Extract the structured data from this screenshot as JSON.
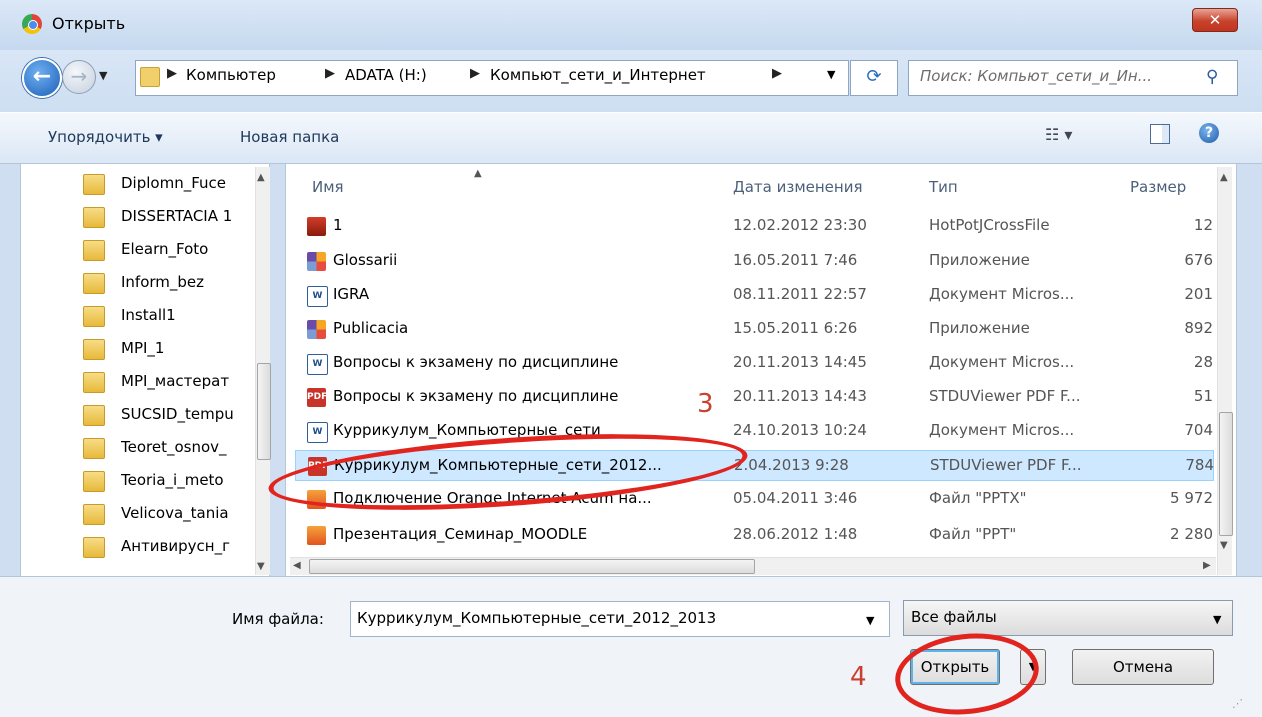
{
  "window": {
    "title": "Открыть",
    "close_label": "✕"
  },
  "nav": {
    "breadcrumbs": [
      "Компьютер",
      "ADATA (H:)",
      "Компьют_сети_и_Интернет"
    ],
    "search_placeholder": "Поиск: Компьют_сети_и_Ин..."
  },
  "toolbar": {
    "organize_label": "Упорядочить ▾",
    "new_folder_label": "Новая папка"
  },
  "sidebar": {
    "items": [
      "Diplomn_Fuce",
      "DISSERTACIA 1",
      "Elearn_Foto",
      "Inform_bez",
      "Install1",
      "MPI_1",
      "MPI_мастерат",
      "SUCSID_tempu",
      "Teoret_osnov_",
      "Teoria_i_meto",
      "Velicova_tania",
      "Антивирусн_г"
    ]
  },
  "columns": {
    "name": "Имя",
    "date": "Дата изменения",
    "type": "Тип",
    "size": "Размер"
  },
  "files": [
    {
      "icon": "hotpot-icon",
      "name": "1",
      "date": "12.02.2012 23:30",
      "type": "HotPotJCrossFile",
      "size": "12"
    },
    {
      "icon": "application-icon",
      "name": "Glossarii",
      "date": "16.05.2011 7:46",
      "type": "Приложение",
      "size": "676"
    },
    {
      "icon": "word-document-icon",
      "name": "IGRA",
      "date": "08.11.2011 22:57",
      "type": "Документ Micros...",
      "size": "201"
    },
    {
      "icon": "application-icon",
      "name": "Publicacia",
      "date": "15.05.2011 6:26",
      "type": "Приложение",
      "size": "892"
    },
    {
      "icon": "word-document-icon",
      "name": "Вопросы к экзамену по дисциплине",
      "date": "20.11.2013 14:45",
      "type": "Документ Micros...",
      "size": "28"
    },
    {
      "icon": "pdf-icon",
      "name": "Вопросы к экзамену по дисциплине",
      "date": "20.11.2013 14:43",
      "type": "STDUViewer PDF F...",
      "size": "51"
    },
    {
      "icon": "word-document-icon",
      "name": "Куррикулум_Компьютерные_сети",
      "date": "24.10.2013 10:24",
      "type": "Документ Micros...",
      "size": "704"
    },
    {
      "icon": "pdf-icon",
      "name": "Куррикулум_Компьютерные_сети_2012...",
      "date": "2.04.2013 9:28",
      "type": "STDUViewer PDF F...",
      "size": "784",
      "selected": true
    },
    {
      "icon": "powerpoint-icon",
      "name": "Подключение Orange Internet Acum на...",
      "date": "05.04.2011 3:46",
      "type": "Файл \"PPTX\"",
      "size": "5 972"
    },
    {
      "icon": "powerpoint-icon",
      "name": "Презентация_Семинар_MOODLE",
      "date": "28.06.2012 1:48",
      "type": "Файл \"PPT\"",
      "size": "2 280"
    }
  ],
  "footer": {
    "filename_label": "Имя файла:",
    "filename_value": "Куррикулум_Компьютерные_сети_2012_2013",
    "filetype_value": "Все файлы",
    "open_label": "Открыть",
    "cancel_label": "Отмена"
  },
  "annotations": {
    "step3": "3",
    "step4": "4",
    "highlight_color": "#e2241e"
  }
}
